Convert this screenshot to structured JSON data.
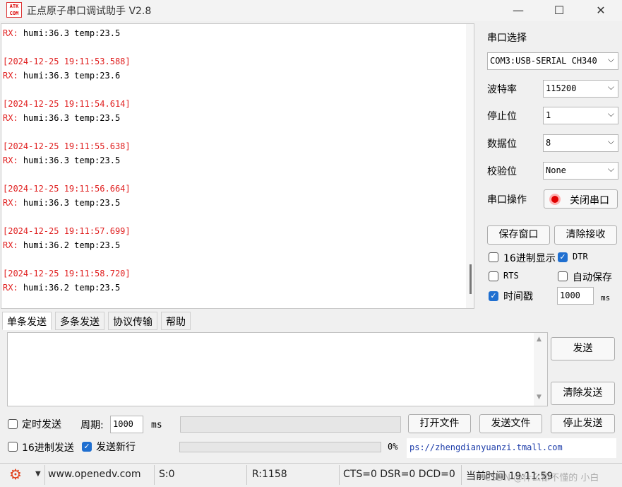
{
  "window": {
    "logo_text": "ATK COM",
    "title": "正点原子串口调试助手 V2.8",
    "minimize": "—",
    "maximize": "☐",
    "close": "✕"
  },
  "rx": {
    "lines": [
      {
        "prefix": "RX:",
        "text": " humi:36.3 temp:23.5"
      },
      {
        "blank": true
      },
      {
        "ts": "[2024-12-25 19:11:53.588]"
      },
      {
        "prefix": "RX:",
        "text": " humi:36.3 temp:23.6"
      },
      {
        "blank": true
      },
      {
        "ts": "[2024-12-25 19:11:54.614]"
      },
      {
        "prefix": "RX:",
        "text": " humi:36.3 temp:23.5"
      },
      {
        "blank": true
      },
      {
        "ts": "[2024-12-25 19:11:55.638]"
      },
      {
        "prefix": "RX:",
        "text": " humi:36.3 temp:23.5"
      },
      {
        "blank": true
      },
      {
        "ts": "[2024-12-25 19:11:56.664]"
      },
      {
        "prefix": "RX:",
        "text": " humi:36.3 temp:23.5"
      },
      {
        "blank": true
      },
      {
        "ts": "[2024-12-25 19:11:57.699]"
      },
      {
        "prefix": "RX:",
        "text": " humi:36.2 temp:23.5"
      },
      {
        "blank": true
      },
      {
        "ts": "[2024-12-25 19:11:58.720]"
      },
      {
        "prefix": "RX:",
        "text": " humi:36.2 temp:23.5"
      }
    ]
  },
  "panel": {
    "port_select_label": "串口选择",
    "port_value": "COM3:USB-SERIAL CH340",
    "baud_label": "波特率",
    "baud_value": "115200",
    "stopbits_label": "停止位",
    "stopbits_value": "1",
    "databits_label": "数据位",
    "databits_value": "8",
    "parity_label": "校验位",
    "parity_value": "None",
    "port_op_label": "串口操作",
    "close_port_button": "关闭串口",
    "save_window_button": "保存窗口",
    "clear_rx_button": "清除接收",
    "hex_display_label": "16进制显示",
    "dtr_label": "DTR",
    "rts_label": "RTS",
    "autosave_label": "自动保存",
    "timestamp_label": "时间戳",
    "timestamp_value": "1000",
    "timestamp_unit": "ms"
  },
  "tabs": [
    "单条发送",
    "多条发送",
    "协议传输",
    "帮助"
  ],
  "send": {
    "send_button": "发送",
    "clear_send_button": "清除发送",
    "timed_send_label": "定时发送",
    "period_label": "周期:",
    "period_value": "1000",
    "period_unit": "ms",
    "open_file_button": "打开文件",
    "send_file_button": "发送文件",
    "stop_send_button": "停止发送",
    "hex_send_label": "16进制发送",
    "send_newline_label": "发送新行",
    "progress_text": "0%",
    "progress": 0,
    "link_text": "ps://zhengdianyuanzi.tmall.com"
  },
  "status": {
    "website": "www.openedv.com",
    "s_count": "S:0",
    "r_count": "R:1158",
    "signals": "CTS=0 DSR=0 DCD=0",
    "time_text": "当前时间 19:11:59",
    "watermark": "CSDN @什么都不懂的 小白"
  },
  "colors": {
    "timestamp": "#e02020",
    "rx_prefix": "#e02020",
    "checkbox_on": "#1f6fd0",
    "link": "#1a3aa8"
  }
}
